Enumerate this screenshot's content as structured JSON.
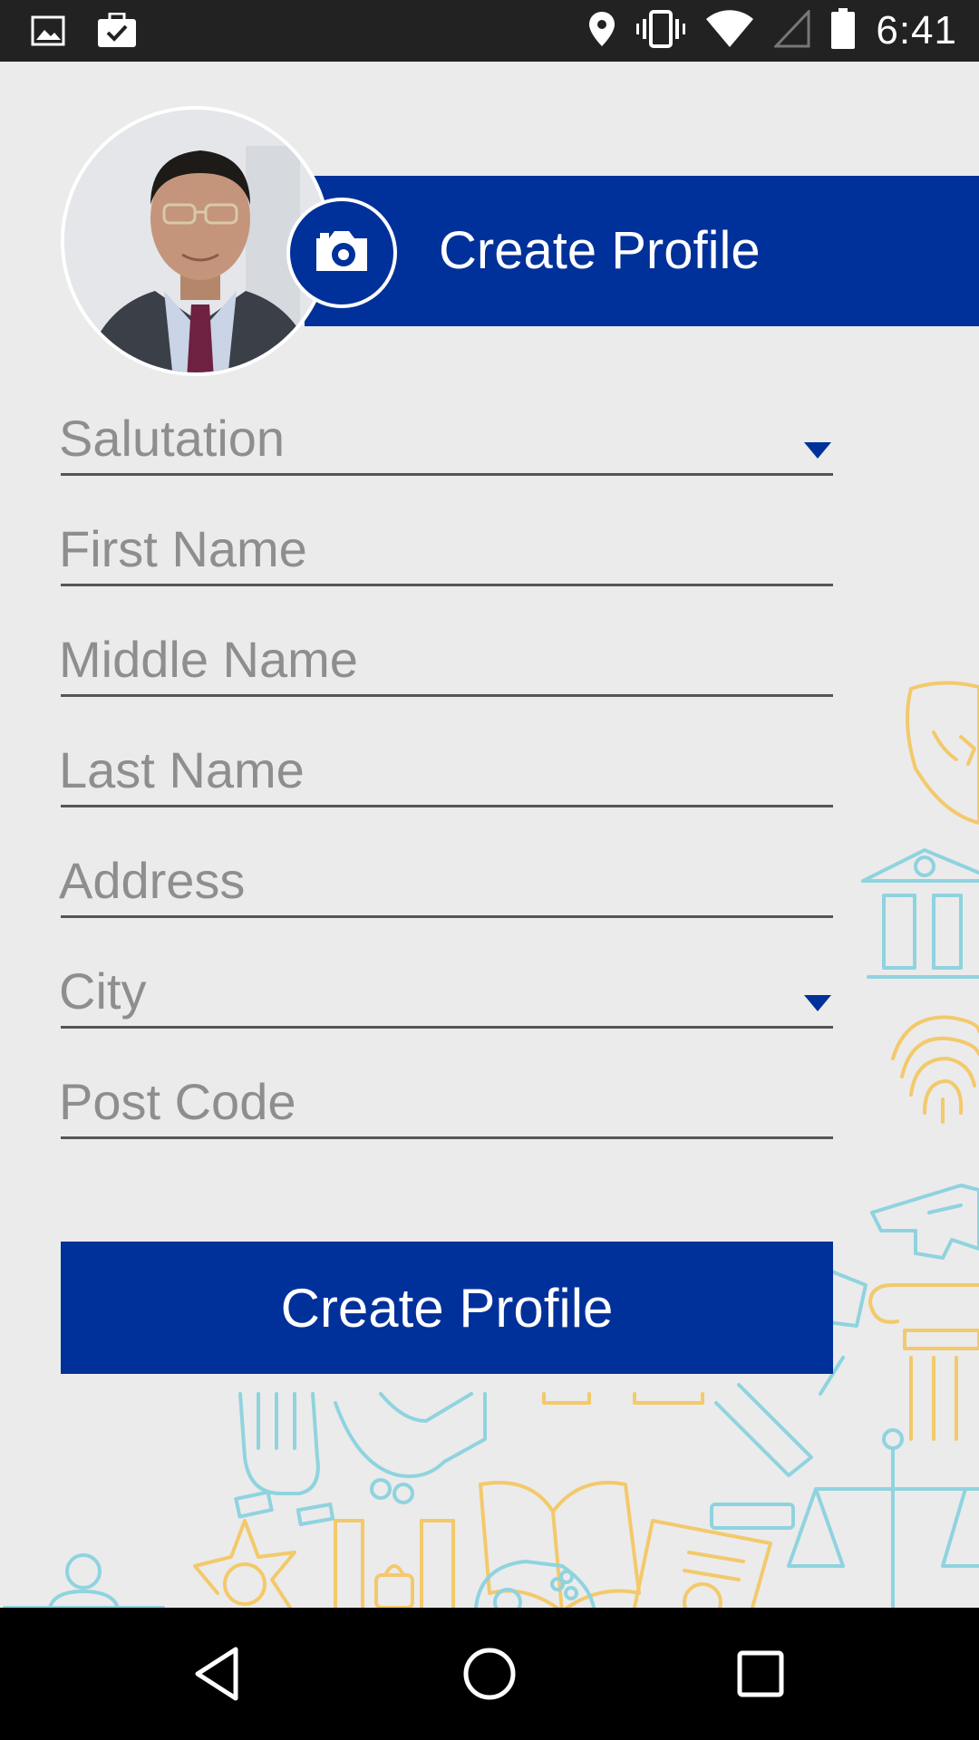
{
  "status_bar": {
    "time": "6:41",
    "left_icons": [
      "image-icon",
      "briefcase-check-icon"
    ],
    "right_icons": [
      "location-pin-icon",
      "vibrate-icon",
      "wifi-icon",
      "cell-signal-icon",
      "battery-icon"
    ]
  },
  "header": {
    "title": "Create Profile"
  },
  "form": {
    "salutation": {
      "placeholder": "Salutation",
      "type": "dropdown"
    },
    "first_name": {
      "placeholder": "First Name"
    },
    "middle_name": {
      "placeholder": "Middle Name"
    },
    "last_name": {
      "placeholder": "Last Name"
    },
    "address": {
      "placeholder": "Address"
    },
    "city": {
      "placeholder": "City",
      "type": "dropdown"
    },
    "post_code": {
      "placeholder": "Post Code"
    }
  },
  "submit": {
    "label": "Create Profile"
  },
  "nav_bar": {
    "items": [
      "back-icon",
      "home-icon",
      "recents-icon"
    ]
  },
  "colors": {
    "accent": "#00319a",
    "background": "#ebebeb",
    "status_bar": "#222222",
    "nav_bar": "#000000",
    "art_yellow": "#f3c96b",
    "art_teal": "#8fd3df"
  }
}
